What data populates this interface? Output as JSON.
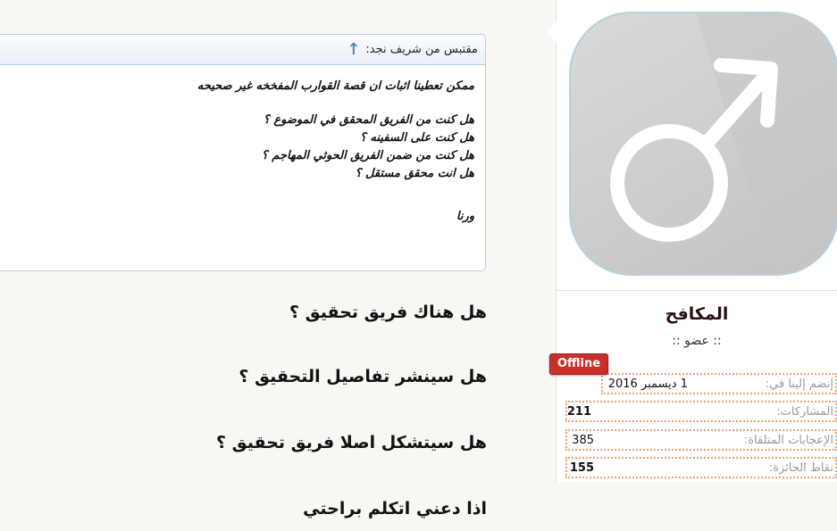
{
  "quote": {
    "header": "مقتبس من شريف نجد:",
    "lines": [
      "ممكن تعطينا اثبات ان قصة القوارب المفخخه غير صحيحه",
      "هل كنت من الفريق المحقق في الموضوع ؟",
      "هل كنت على السفينه ؟",
      "هل كنت من ضمن الفريق الحوثي المهاجم ؟",
      "هل انت محقق مستقل ؟",
      "ورنا"
    ]
  },
  "post": {
    "questions": [
      "هل هناك فريق تحقيق ؟",
      "هل سينشر تفاصيل التحقيق ؟",
      "هل سيتشكل اصلا فريق تحقيق ؟",
      "اذا دعني اتكلم براحتي"
    ]
  },
  "profile": {
    "avatar_icon": "male-symbol-icon",
    "username": "المكافح",
    "rank": ":: عضو ::",
    "status": "Offline",
    "status_color": "#c9302c",
    "stats": [
      {
        "label": "إنضم إلينا في:",
        "value": "1 ديسمبر 2016"
      },
      {
        "label": "المشاركات:",
        "value": "211"
      },
      {
        "label": "الإعجابات المتلقاة:",
        "value": "385"
      },
      {
        "label": "نقاط الجائزة:",
        "value": "155"
      }
    ]
  }
}
